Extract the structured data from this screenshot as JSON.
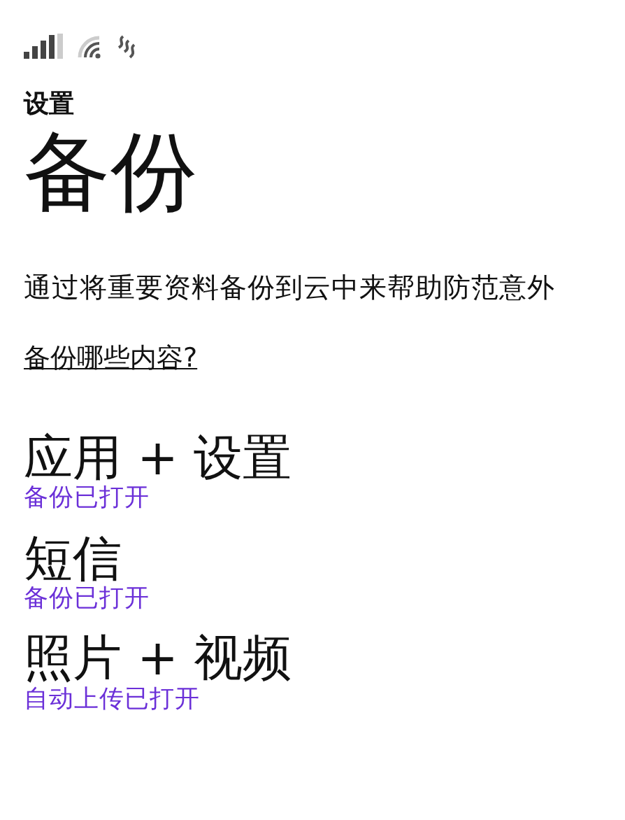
{
  "header": {
    "section": "设置",
    "title": "备份"
  },
  "description": "通过将重要资料备份到云中来帮助防范意外",
  "link": "备份哪些内容?",
  "items": [
    {
      "title": "应用 + 设置",
      "status": "备份已打开"
    },
    {
      "title": "短信",
      "status": "备份已打开"
    },
    {
      "title": "照片 + 视频",
      "status": "自动上传已打开"
    }
  ]
}
